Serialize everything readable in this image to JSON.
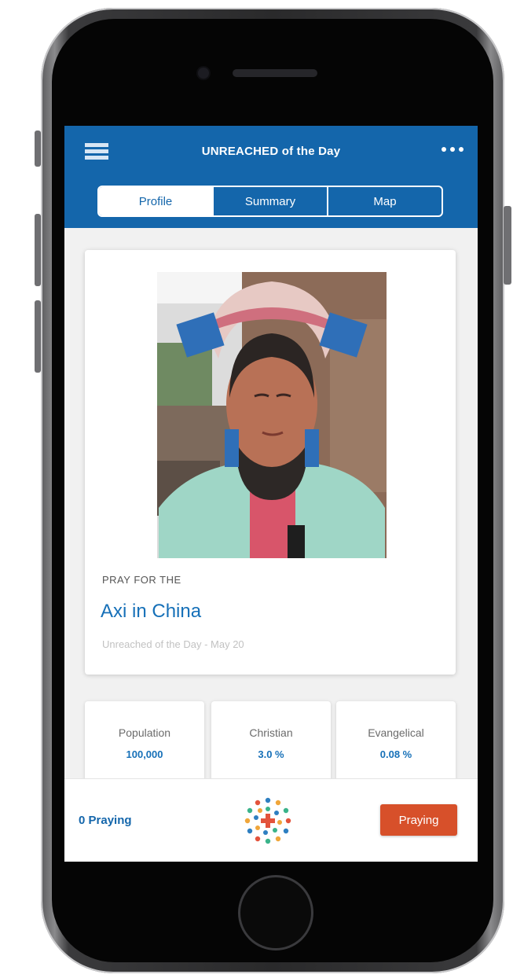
{
  "header": {
    "title": "UNREACHED of the Day",
    "menu_icon": "hamburger-menu-icon",
    "more_icon": "more-options-icon"
  },
  "tabs": [
    {
      "label": "Profile",
      "active": true
    },
    {
      "label": "Summary",
      "active": false
    },
    {
      "label": "Map",
      "active": false
    }
  ],
  "profile": {
    "pray_label": "PRAY FOR THE",
    "people_name": "Axi in China",
    "subtitle": "Unreached of the Day - May 20"
  },
  "stats": [
    {
      "label": "Population",
      "value": "100,000"
    },
    {
      "label": "Christian",
      "value": "3.0 %"
    },
    {
      "label": "Evangelical",
      "value": "0.08 %"
    }
  ],
  "bottom_bar": {
    "praying_count": "0 Praying",
    "praying_button": "Praying",
    "logo_icon": "app-logo-icon"
  },
  "colors": {
    "header_blue": "#1466ab",
    "accent_orange": "#d7502a",
    "link_blue": "#1670b8"
  }
}
